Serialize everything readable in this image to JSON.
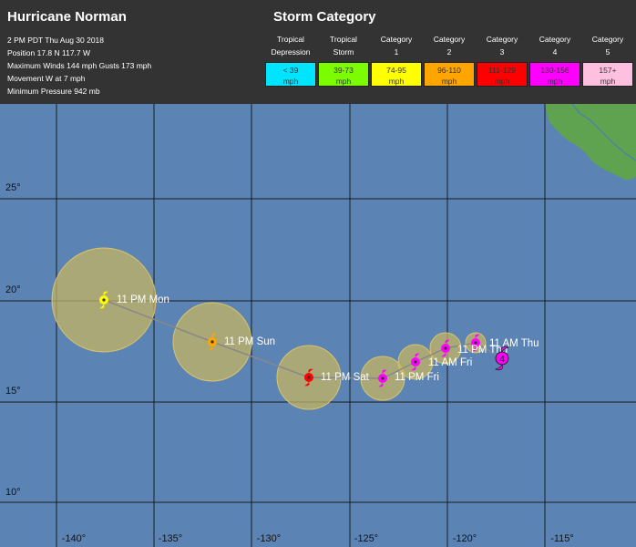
{
  "header": {
    "storm_name": "Hurricane Norman",
    "info": [
      "2 PM PDT Thu Aug 30 2018",
      "Position 17.8 N 117.7 W",
      "Maximum Winds 144 mph Gusts 173 mph",
      "Movement W at 7 mph",
      "Minimum Pressure 942 mb"
    ]
  },
  "legend": {
    "title": "Storm Category",
    "categories": [
      {
        "line1": "Tropical",
        "line2": "Depression",
        "range": "< 39",
        "unit": "mph",
        "color": "#00e5ff"
      },
      {
        "line1": "Tropical",
        "line2": "Storm",
        "range": "39-73",
        "unit": "mph",
        "color": "#7cfc00"
      },
      {
        "line1": "Category",
        "line2": "1",
        "range": "74-95",
        "unit": "mph",
        "color": "#ffff00"
      },
      {
        "line1": "Category",
        "line2": "2",
        "range": "96-110",
        "unit": "mph",
        "color": "#ffa500"
      },
      {
        "line1": "Category",
        "line2": "3",
        "range": "111-129",
        "unit": "mph",
        "color": "#ff0000"
      },
      {
        "line1": "Category",
        "line2": "4",
        "range": "130-156",
        "unit": "mph",
        "color": "#ff00ff"
      },
      {
        "line1": "Category",
        "line2": "5",
        "range": "157+",
        "unit": "mph",
        "color": "#ffc0e0"
      }
    ]
  },
  "map": {
    "lat_labels": [
      "25°",
      "20°",
      "15°",
      "10°"
    ],
    "lon_labels": [
      "-140°",
      "-135°",
      "-130°",
      "-125°",
      "-120°",
      "-115°"
    ],
    "colors": {
      "ocean": "#5b84b5",
      "land": "#5fa24f",
      "grid": "#1a1a1a",
      "cone": "#c9b560",
      "track": "#888888"
    },
    "current_position": {
      "label": "4",
      "color": "#ff00ff"
    },
    "forecast_points": [
      {
        "label": "11 AM Thu",
        "color": "#ff00ff"
      },
      {
        "label": "11 PM Thu",
        "color": "#ff00ff"
      },
      {
        "label": "11 AM Fri",
        "color": "#ff00ff"
      },
      {
        "label": "11 PM Fri",
        "color": "#ff00ff"
      },
      {
        "label": "11 PM Sat",
        "color": "#ff0000"
      },
      {
        "label": "11 PM Sun",
        "color": "#ffa500"
      },
      {
        "label": "11 PM Mon",
        "color": "#ffff00"
      }
    ]
  }
}
